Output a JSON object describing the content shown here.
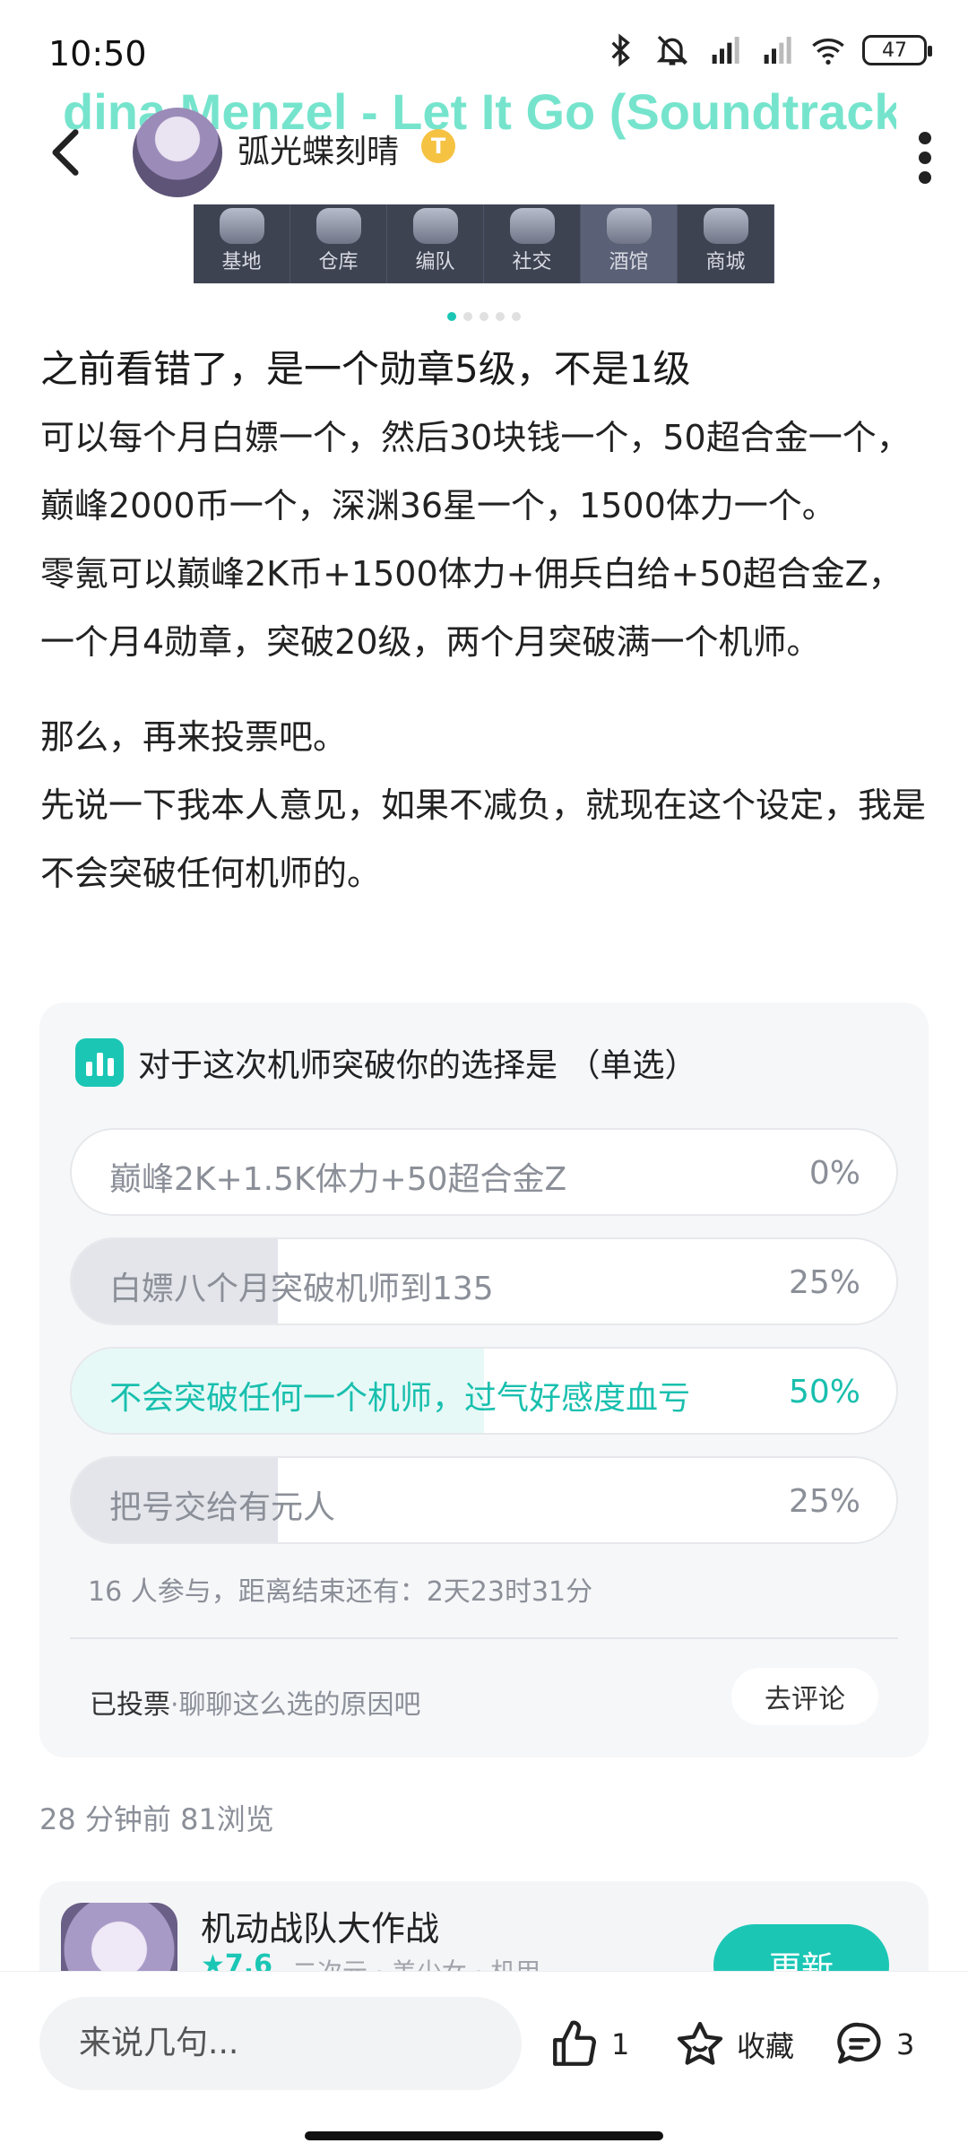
{
  "status_bar": {
    "time": "10:50",
    "battery": "47"
  },
  "lyric_overlay": "dina Menzel - Let It Go (Soundtrack Ve",
  "header": {
    "username": "弧光蝶刻晴",
    "badge": "T"
  },
  "banner": {
    "tabs": [
      "基地",
      "仓库",
      "编队",
      "社交",
      "酒馆",
      "商城"
    ],
    "active_tab": 4,
    "dot_count": 5,
    "active_dot": 0
  },
  "post": {
    "title": "之前看错了，是一个勋章5级，不是1级",
    "paragraphs": [
      "可以每个月白嫖一个，然后30块钱一个，50超合金一个，巅峰2000币一个，深渊36星一个，1500体力一个。",
      "零氪可以巅峰2K币+1500体力+佣兵白给+50超合金Z，一个月4勋章，突破20级，两个月突破满一个机师。",
      "那么，再来投票吧。",
      "先说一下我本人意见，如果不减负，就现在这个设定，我是不会突破任何机师的。"
    ]
  },
  "poll": {
    "question": "对于这次机师突破你的选择是 （单选）",
    "options": [
      {
        "label": "巅峰2K+1.5K体力+50超合金Z",
        "pct": "0%",
        "share": 0,
        "selected": false
      },
      {
        "label": "白嫖八个月突破机师到135",
        "pct": "25%",
        "share": 0.25,
        "selected": false
      },
      {
        "label": "不会突破任何一个机师，过气好感度血亏",
        "pct": "50%",
        "share": 0.5,
        "selected": true
      },
      {
        "label": "把号交给有元人",
        "pct": "25%",
        "share": 0.25,
        "selected": false
      }
    ],
    "info": "16 人参与，距离结束还有：2天23时31分",
    "voted": "已投票",
    "voted_hint": "·聊聊这么选的原因吧",
    "comment_button": "去评论"
  },
  "meta": "28 分钟前   81浏览",
  "game": {
    "name": "机动战队大作战",
    "rating": "★7.6",
    "tags": "二次元 · 美少女 · 机甲",
    "button": "更新"
  },
  "bottom_bar": {
    "input_placeholder": "来说几句...",
    "like_count": "1",
    "favorite_label": "收藏",
    "comment_count": "3"
  }
}
